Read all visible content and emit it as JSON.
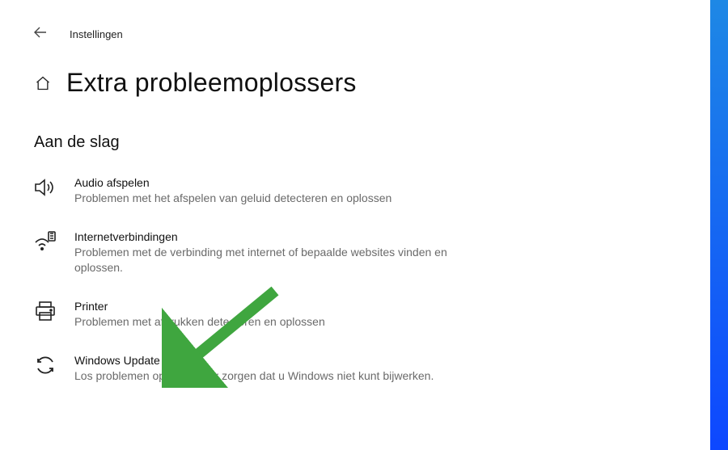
{
  "header": {
    "app_title": "Instellingen",
    "page_title": "Extra probleemoplossers"
  },
  "section": {
    "heading": "Aan de slag"
  },
  "items": [
    {
      "title": "Audio afspelen",
      "desc": "Problemen met het afspelen van geluid detecteren en oplossen"
    },
    {
      "title": "Internetverbindingen",
      "desc": "Problemen met de verbinding met internet of bepaalde websites vinden en oplossen."
    },
    {
      "title": "Printer",
      "desc": "Problemen met afdrukken detecteren en oplossen"
    },
    {
      "title": "Windows Update",
      "desc": "Los problemen op die ervoor zorgen dat u Windows niet kunt bijwerken."
    }
  ],
  "annotation": {
    "arrow_color": "#3fa63f"
  }
}
